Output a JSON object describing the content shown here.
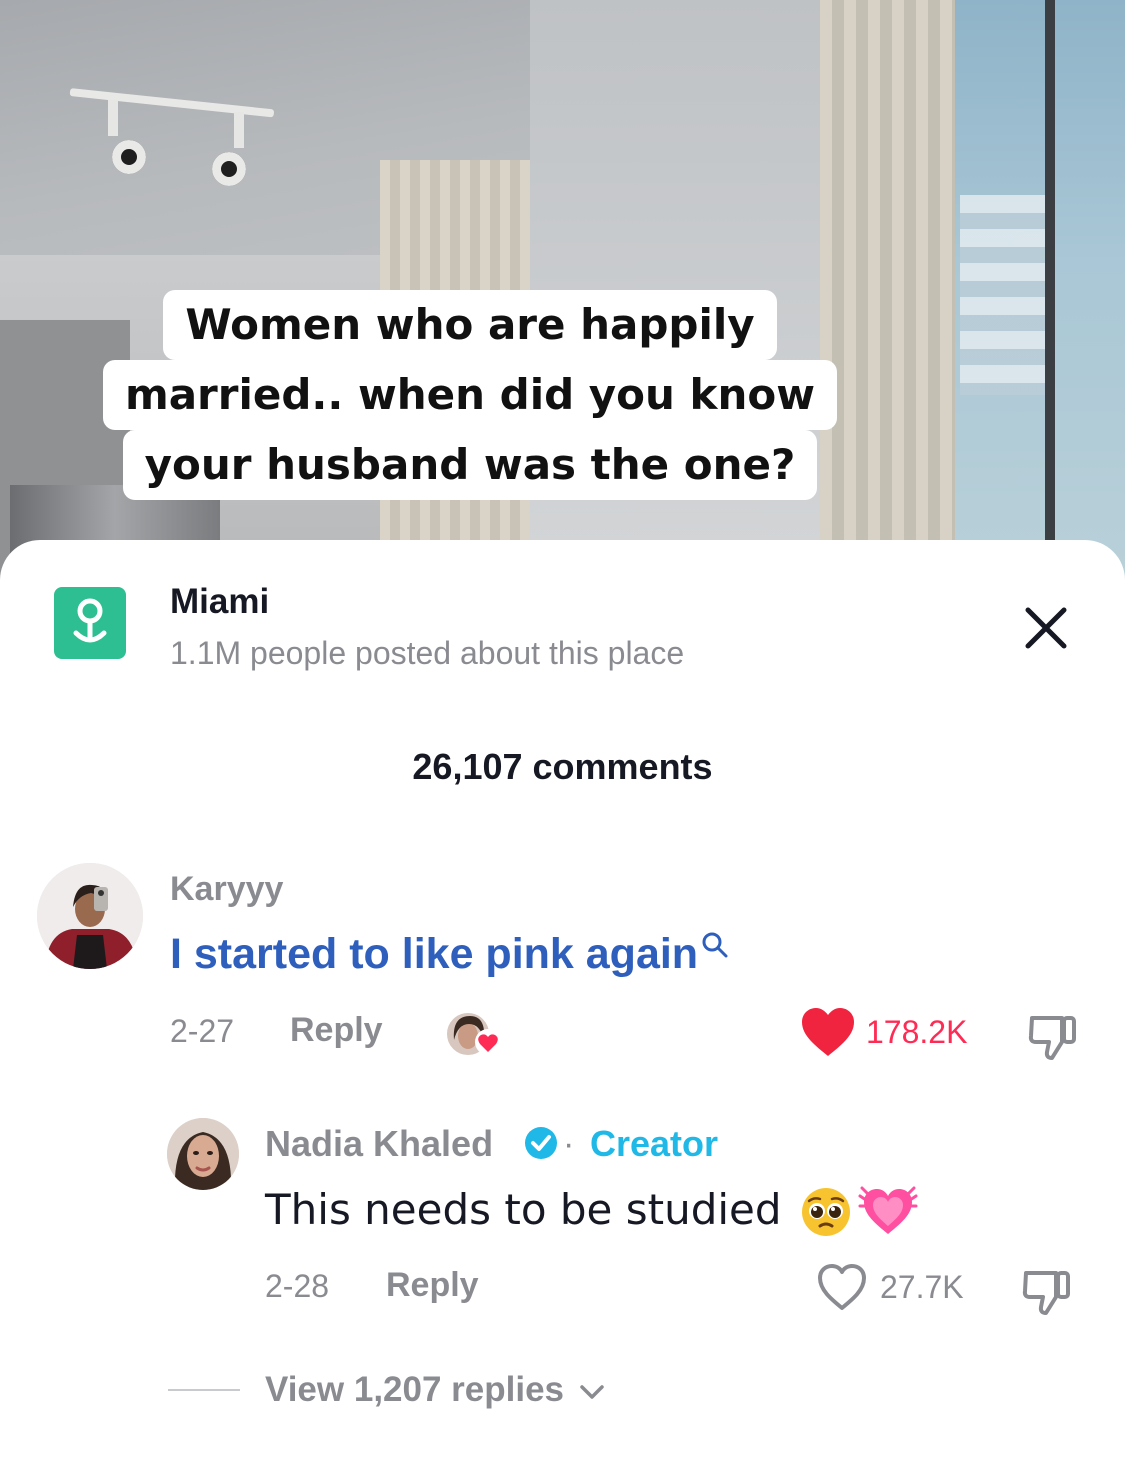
{
  "video": {
    "caption_lines": [
      "Women who are happily",
      "married.. when did you know",
      "your husband was the one?"
    ]
  },
  "location": {
    "name": "Miami",
    "subtitle": "1.1M people posted about this place",
    "icon": "location-pin-icon"
  },
  "comments_header": {
    "count_label": "26,107 comments"
  },
  "comments": [
    {
      "username": "Karyyy",
      "text": "I started to like pink again",
      "date": "2-27",
      "reply_label": "Reply",
      "likes": "178.2K",
      "liked": true,
      "creator_liked": true
    }
  ],
  "replies": [
    {
      "username": "Nadia Khaled",
      "verified": true,
      "separator": "·",
      "badge": "Creator",
      "text": "This needs to be studied",
      "emojis": [
        "pleading-face",
        "growing-heart"
      ],
      "date": "2-28",
      "reply_label": "Reply",
      "likes": "27.7K",
      "liked": false
    }
  ],
  "view_replies_label": "View 1,207 replies",
  "colors": {
    "accent_red": "#fe2c55",
    "heart_red": "#f0243f",
    "link_blue": "#2f5fbd",
    "creator_cyan": "#20b8e6",
    "place_green": "#2dbf91",
    "muted_gray": "#8a8b91"
  }
}
